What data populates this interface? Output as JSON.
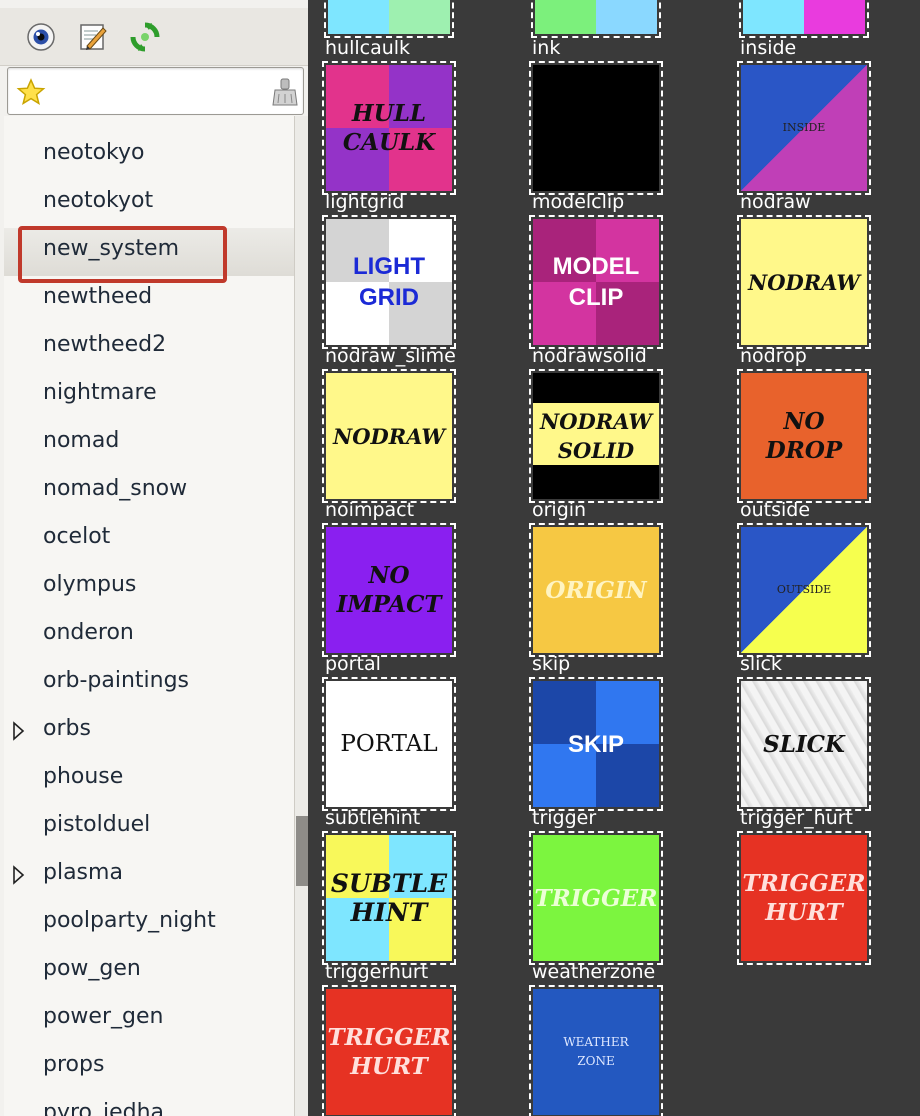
{
  "toolbar": {
    "view_icon": "eye-icon",
    "edit_icon": "edit-icon",
    "refresh_icon": "refresh-icon"
  },
  "search": {
    "value": "",
    "placeholder": "",
    "star_icon": "star-icon",
    "clear_icon": "clear-icon"
  },
  "tree": {
    "partial_top": "_",
    "items": [
      {
        "label": "neotokyo",
        "expandable": false
      },
      {
        "label": "neotokyot",
        "expandable": false
      },
      {
        "label": "new_system",
        "expandable": false,
        "selected": true
      },
      {
        "label": "newtheed",
        "expandable": false
      },
      {
        "label": "newtheed2",
        "expandable": false
      },
      {
        "label": "nightmare",
        "expandable": false
      },
      {
        "label": "nomad",
        "expandable": false
      },
      {
        "label": "nomad_snow",
        "expandable": false
      },
      {
        "label": "ocelot",
        "expandable": false
      },
      {
        "label": "olympus",
        "expandable": false
      },
      {
        "label": "onderon",
        "expandable": false
      },
      {
        "label": "orb-paintings",
        "expandable": false
      },
      {
        "label": "orbs",
        "expandable": true
      },
      {
        "label": "phouse",
        "expandable": false
      },
      {
        "label": "pistolduel",
        "expandable": false
      },
      {
        "label": "plasma",
        "expandable": true
      },
      {
        "label": "poolparty_night",
        "expandable": false
      },
      {
        "label": "pow_gen",
        "expandable": false
      },
      {
        "label": "power_gen",
        "expandable": false
      },
      {
        "label": "props",
        "expandable": false
      },
      {
        "label": "pyro_jedha",
        "expandable": false
      }
    ]
  },
  "textures": [
    {
      "name": "hullcaulk",
      "text": "HULL\nCAULK",
      "style": "quad",
      "colors": [
        "#e2338c",
        "#9433c8",
        "#9433c8",
        "#e2338c"
      ],
      "text_color": "#111111",
      "font": "serif"
    },
    {
      "name": "ink",
      "text": "",
      "style": "solid",
      "colors": [
        "#000000"
      ],
      "text_color": "#000000",
      "font": "sans"
    },
    {
      "name": "inside",
      "text": "INSIDE",
      "style": "diag",
      "colors": [
        "#2a56c6",
        "#c03fb7"
      ],
      "text_color": "#222222",
      "font": "serifsmall"
    },
    {
      "name": "lightgrid",
      "text": "LIGHT\nGRID",
      "style": "quad",
      "colors": [
        "#d4d4d4",
        "#ffffff",
        "#ffffff",
        "#d4d4d4"
      ],
      "text_color": "#1b2ad6",
      "font": "sans"
    },
    {
      "name": "modelclip",
      "text": "MODEL\nCLIP",
      "style": "quad",
      "colors": [
        "#a9237b",
        "#d334a0",
        "#d334a0",
        "#a9237b"
      ],
      "text_color": "#ffffff",
      "font": "sans"
    },
    {
      "name": "nodraw",
      "text": "NODRAW",
      "style": "solid",
      "colors": [
        "#fff88a"
      ],
      "text_color": "#111111",
      "font": "serif"
    },
    {
      "name": "nodraw_slime",
      "text": "NODRAW",
      "style": "solid",
      "colors": [
        "#fff88a"
      ],
      "text_color": "#111111",
      "font": "serif"
    },
    {
      "name": "nodrawsolid",
      "text": "NODRAW\nSOLID",
      "style": "band",
      "colors": [
        "#000000",
        "#fff88a"
      ],
      "text_color": "#111111",
      "font": "serif"
    },
    {
      "name": "nodrop",
      "text": "NO\nDROP",
      "style": "solid",
      "colors": [
        "#e8622c"
      ],
      "text_color": "#111111",
      "font": "serif"
    },
    {
      "name": "noimpact",
      "text": "NO\nIMPACT",
      "style": "solid",
      "colors": [
        "#8a1ff0"
      ],
      "text_color": "#111111",
      "font": "serif"
    },
    {
      "name": "origin",
      "text": "ORIGIN",
      "style": "solid",
      "colors": [
        "#f6c843"
      ],
      "text_color": "#fff4c2",
      "font": "serif"
    },
    {
      "name": "outside",
      "text": "OUTSIDE",
      "style": "diag",
      "colors": [
        "#2a56c6",
        "#f6ff4e"
      ],
      "text_color": "#222222",
      "font": "serifsmall"
    },
    {
      "name": "portal",
      "text": "PORTAL",
      "style": "solid",
      "colors": [
        "#ffffff"
      ],
      "text_color": "#111111",
      "font": "serifplain"
    },
    {
      "name": "skip",
      "text": "SKIP",
      "style": "quad",
      "colors": [
        "#1c47a8",
        "#3077f0",
        "#3077f0",
        "#1c47a8"
      ],
      "text_color": "#ffffff",
      "font": "sans"
    },
    {
      "name": "slick",
      "text": "SLICK",
      "style": "solid",
      "colors": [
        "#e6e6e6"
      ],
      "text_color": "#111111",
      "font": "serif"
    },
    {
      "name": "subtlehint",
      "text": "SUBTLE\nHINT",
      "style": "quad",
      "colors": [
        "#f8f85a",
        "#7ee6ff",
        "#7ee6ff",
        "#f8f85a"
      ],
      "text_color": "#111111",
      "font": "serif"
    },
    {
      "name": "trigger",
      "text": "TRIGGER",
      "style": "solid",
      "colors": [
        "#7cf53f"
      ],
      "text_color": "#ecffd6",
      "font": "serif"
    },
    {
      "name": "trigger_hurt",
      "text": "TRIGGER\nHURT",
      "style": "solid",
      "colors": [
        "#e63223"
      ],
      "text_color": "#ffe0dc",
      "font": "serif"
    },
    {
      "name": "triggerhurt",
      "text": "TRIGGER\nHURT",
      "style": "solid",
      "colors": [
        "#e63223"
      ],
      "text_color": "#ffe0dc",
      "font": "serif"
    },
    {
      "name": "weatherzone",
      "text": "WEATHER\nZONE",
      "style": "solid",
      "colors": [
        "#2358c0"
      ],
      "text_color": "#dfe8ff",
      "font": "serifsmallplain"
    }
  ],
  "top_partial_tiles": [
    {
      "colors": [
        "#7ee6ff",
        "#9ef0b0"
      ]
    },
    {
      "colors": [
        "#7cf07c",
        "#8ad8ff"
      ]
    },
    {
      "colors": [
        "#7ee6ff",
        "#e93bde"
      ]
    }
  ]
}
